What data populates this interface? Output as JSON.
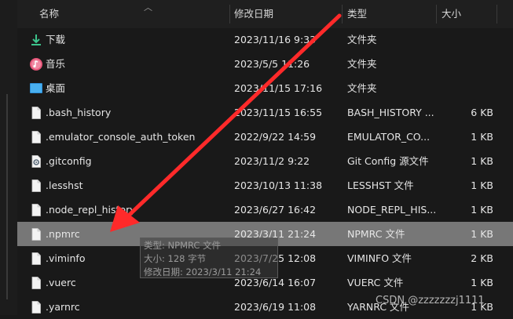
{
  "header": {
    "name_label": "名称",
    "date_label": "修改日期",
    "type_label": "类型",
    "size_label": "大小"
  },
  "rows": [
    {
      "name": "下载",
      "date": "2023/11/16 9:33",
      "type": "文件夹",
      "size": "",
      "icon": "download-icon"
    },
    {
      "name": "音乐",
      "date": "2023/5/5 11:26",
      "type": "文件夹",
      "size": "",
      "icon": "music-icon"
    },
    {
      "name": "桌面",
      "date": "2023/11/15 17:16",
      "type": "文件夹",
      "size": "",
      "icon": "desktop-icon"
    },
    {
      "name": ".bash_history",
      "date": "2023/11/15 16:55",
      "type": "BASH_HISTORY ...",
      "size": "6 KB",
      "icon": "file-icon"
    },
    {
      "name": ".emulator_console_auth_token",
      "date": "2022/9/22 14:59",
      "type": "EMULATOR_CO...",
      "size": "1 KB",
      "icon": "file-icon"
    },
    {
      "name": ".gitconfig",
      "date": "2023/11/2 9:22",
      "type": "Git Config 源文件",
      "size": "1 KB",
      "icon": "gear-file-icon"
    },
    {
      "name": ".lesshst",
      "date": "2023/10/13 11:38",
      "type": "LESSHST 文件",
      "size": "1 KB",
      "icon": "file-icon"
    },
    {
      "name": ".node_repl_history",
      "date": "2023/6/27 16:42",
      "type": "NODE_REPL_HIS...",
      "size": "1 KB",
      "icon": "file-icon"
    },
    {
      "name": ".npmrc",
      "date": "2023/3/11 21:24",
      "type": "NPMRC 文件",
      "size": "1 KB",
      "icon": "file-icon",
      "selected": true
    },
    {
      "name": ".viminfo",
      "date": "2023/7/25 12:08",
      "type": "VIMINFO 文件",
      "size": "2 KB",
      "icon": "file-icon"
    },
    {
      "name": ".vuerc",
      "date": "2023/6/14 16:07",
      "type": "VUERC 文件",
      "size": "1 KB",
      "icon": "file-icon"
    },
    {
      "name": ".yarnrc",
      "date": "2023/6/19 11:08",
      "type": "YARNRC 文件",
      "size": "1 KB",
      "icon": "file-icon"
    }
  ],
  "tooltip": {
    "type_line": "类型: NPMRC 文件",
    "size_line": "大小: 128 字节",
    "date_line": "修改日期: 2023/3/11 21:24"
  },
  "watermark": "CSDN @zzzzzzzj1111",
  "colors": {
    "background": "#191919",
    "selected_row": "#777777",
    "annotation_arrow": "#ff2a2a"
  }
}
